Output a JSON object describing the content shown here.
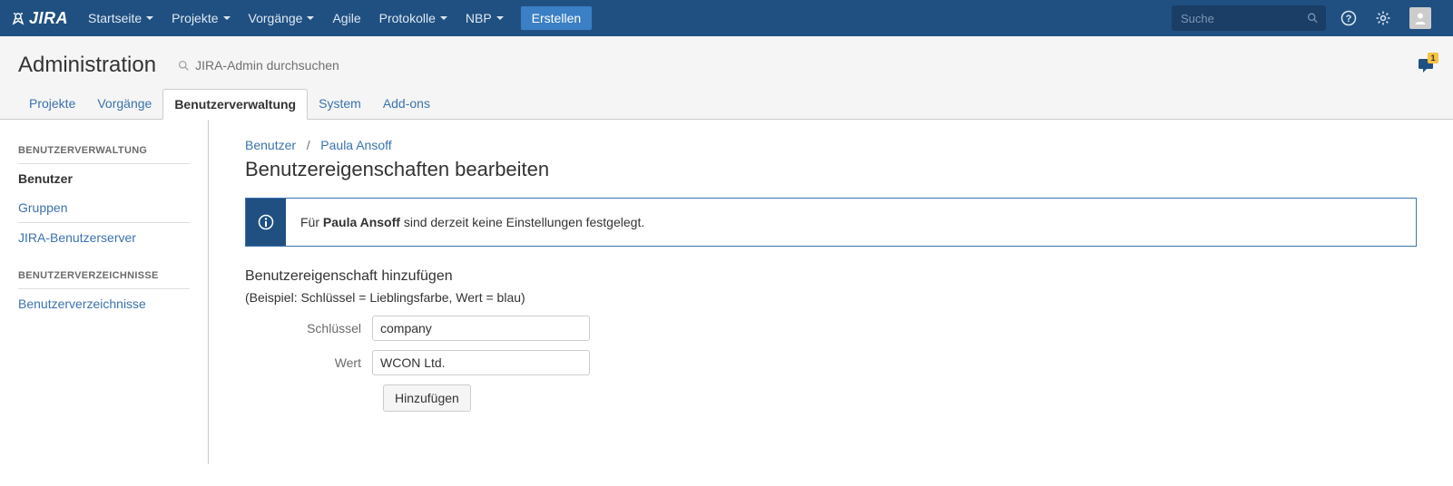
{
  "topnav": {
    "logo_text": "JIRA",
    "items": [
      "Startseite",
      "Projekte",
      "Vorgänge",
      "Agile",
      "Protokolle",
      "NBP"
    ],
    "create_label": "Erstellen",
    "search_placeholder": "Suche"
  },
  "admin": {
    "title": "Administration",
    "search_placeholder": "JIRA-Admin durchsuchen",
    "feedback_badge": "1",
    "tabs": [
      "Projekte",
      "Vorgänge",
      "Benutzerverwaltung",
      "System",
      "Add-ons"
    ],
    "active_tab_index": 2
  },
  "sidebar": {
    "section1_title": "BENUTZERVERWALTUNG",
    "section1_items": [
      "Benutzer",
      "Gruppen",
      "JIRA-Benutzerserver"
    ],
    "section1_active_index": 0,
    "section2_title": "BENUTZERVERZEICHNISSE",
    "section2_items": [
      "Benutzerverzeichnisse"
    ]
  },
  "breadcrumb": {
    "root": "Benutzer",
    "separator": "/",
    "current": "Paula Ansoff"
  },
  "page": {
    "heading": "Benutzereigenschaften bearbeiten",
    "info_prefix": "Für ",
    "info_name": "Paula Ansoff",
    "info_suffix": " sind derzeit keine Einstellungen festgelegt.",
    "section_heading": "Benutzereigenschaft hinzufügen",
    "hint": "(Beispiel: Schlüssel = Lieblingsfarbe, Wert = blau)",
    "label_key": "Schlüssel",
    "label_value": "Wert",
    "value_key": "company",
    "value_val": "WCON Ltd.",
    "submit_label": "Hinzufügen"
  }
}
